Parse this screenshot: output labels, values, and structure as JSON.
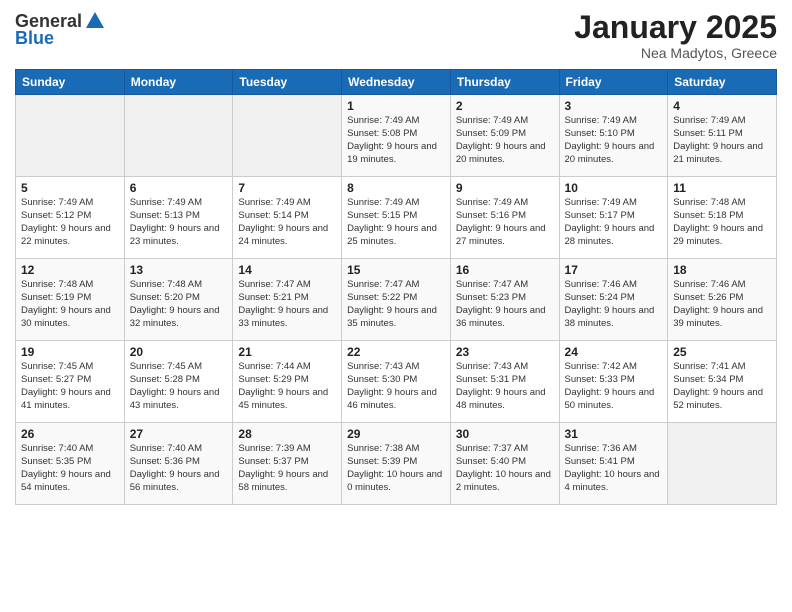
{
  "header": {
    "logo_general": "General",
    "logo_blue": "Blue",
    "title": "January 2025",
    "subtitle": "Nea Madytos, Greece"
  },
  "weekdays": [
    "Sunday",
    "Monday",
    "Tuesday",
    "Wednesday",
    "Thursday",
    "Friday",
    "Saturday"
  ],
  "weeks": [
    [
      {
        "day": "",
        "info": ""
      },
      {
        "day": "",
        "info": ""
      },
      {
        "day": "",
        "info": ""
      },
      {
        "day": "1",
        "info": "Sunrise: 7:49 AM\nSunset: 5:08 PM\nDaylight: 9 hours and 19 minutes."
      },
      {
        "day": "2",
        "info": "Sunrise: 7:49 AM\nSunset: 5:09 PM\nDaylight: 9 hours and 20 minutes."
      },
      {
        "day": "3",
        "info": "Sunrise: 7:49 AM\nSunset: 5:10 PM\nDaylight: 9 hours and 20 minutes."
      },
      {
        "day": "4",
        "info": "Sunrise: 7:49 AM\nSunset: 5:11 PM\nDaylight: 9 hours and 21 minutes."
      }
    ],
    [
      {
        "day": "5",
        "info": "Sunrise: 7:49 AM\nSunset: 5:12 PM\nDaylight: 9 hours and 22 minutes."
      },
      {
        "day": "6",
        "info": "Sunrise: 7:49 AM\nSunset: 5:13 PM\nDaylight: 9 hours and 23 minutes."
      },
      {
        "day": "7",
        "info": "Sunrise: 7:49 AM\nSunset: 5:14 PM\nDaylight: 9 hours and 24 minutes."
      },
      {
        "day": "8",
        "info": "Sunrise: 7:49 AM\nSunset: 5:15 PM\nDaylight: 9 hours and 25 minutes."
      },
      {
        "day": "9",
        "info": "Sunrise: 7:49 AM\nSunset: 5:16 PM\nDaylight: 9 hours and 27 minutes."
      },
      {
        "day": "10",
        "info": "Sunrise: 7:49 AM\nSunset: 5:17 PM\nDaylight: 9 hours and 28 minutes."
      },
      {
        "day": "11",
        "info": "Sunrise: 7:48 AM\nSunset: 5:18 PM\nDaylight: 9 hours and 29 minutes."
      }
    ],
    [
      {
        "day": "12",
        "info": "Sunrise: 7:48 AM\nSunset: 5:19 PM\nDaylight: 9 hours and 30 minutes."
      },
      {
        "day": "13",
        "info": "Sunrise: 7:48 AM\nSunset: 5:20 PM\nDaylight: 9 hours and 32 minutes."
      },
      {
        "day": "14",
        "info": "Sunrise: 7:47 AM\nSunset: 5:21 PM\nDaylight: 9 hours and 33 minutes."
      },
      {
        "day": "15",
        "info": "Sunrise: 7:47 AM\nSunset: 5:22 PM\nDaylight: 9 hours and 35 minutes."
      },
      {
        "day": "16",
        "info": "Sunrise: 7:47 AM\nSunset: 5:23 PM\nDaylight: 9 hours and 36 minutes."
      },
      {
        "day": "17",
        "info": "Sunrise: 7:46 AM\nSunset: 5:24 PM\nDaylight: 9 hours and 38 minutes."
      },
      {
        "day": "18",
        "info": "Sunrise: 7:46 AM\nSunset: 5:26 PM\nDaylight: 9 hours and 39 minutes."
      }
    ],
    [
      {
        "day": "19",
        "info": "Sunrise: 7:45 AM\nSunset: 5:27 PM\nDaylight: 9 hours and 41 minutes."
      },
      {
        "day": "20",
        "info": "Sunrise: 7:45 AM\nSunset: 5:28 PM\nDaylight: 9 hours and 43 minutes."
      },
      {
        "day": "21",
        "info": "Sunrise: 7:44 AM\nSunset: 5:29 PM\nDaylight: 9 hours and 45 minutes."
      },
      {
        "day": "22",
        "info": "Sunrise: 7:43 AM\nSunset: 5:30 PM\nDaylight: 9 hours and 46 minutes."
      },
      {
        "day": "23",
        "info": "Sunrise: 7:43 AM\nSunset: 5:31 PM\nDaylight: 9 hours and 48 minutes."
      },
      {
        "day": "24",
        "info": "Sunrise: 7:42 AM\nSunset: 5:33 PM\nDaylight: 9 hours and 50 minutes."
      },
      {
        "day": "25",
        "info": "Sunrise: 7:41 AM\nSunset: 5:34 PM\nDaylight: 9 hours and 52 minutes."
      }
    ],
    [
      {
        "day": "26",
        "info": "Sunrise: 7:40 AM\nSunset: 5:35 PM\nDaylight: 9 hours and 54 minutes."
      },
      {
        "day": "27",
        "info": "Sunrise: 7:40 AM\nSunset: 5:36 PM\nDaylight: 9 hours and 56 minutes."
      },
      {
        "day": "28",
        "info": "Sunrise: 7:39 AM\nSunset: 5:37 PM\nDaylight: 9 hours and 58 minutes."
      },
      {
        "day": "29",
        "info": "Sunrise: 7:38 AM\nSunset: 5:39 PM\nDaylight: 10 hours and 0 minutes."
      },
      {
        "day": "30",
        "info": "Sunrise: 7:37 AM\nSunset: 5:40 PM\nDaylight: 10 hours and 2 minutes."
      },
      {
        "day": "31",
        "info": "Sunrise: 7:36 AM\nSunset: 5:41 PM\nDaylight: 10 hours and 4 minutes."
      },
      {
        "day": "",
        "info": ""
      }
    ]
  ]
}
